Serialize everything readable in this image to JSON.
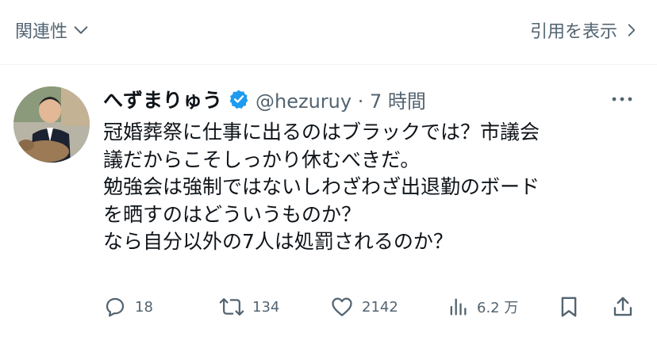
{
  "top_bar": {
    "related_label": "関連性",
    "quotes_label": "引用を表示"
  },
  "tweet": {
    "display_name": "へずまりゅう",
    "handle_time": "@hezuruy · 7 時間",
    "lines": [
      "冠婚葬祭に仕事に出るのはブラックでは？市議会",
      "議だからこそしっかり休むべきだ。",
      "勉強会は強制ではないしわざわざ出退勤のボード",
      "を晒すのはどういうものか？",
      "なら自分以外の7人は処罰されるのか？"
    ],
    "verified_color": "#1d9bf0"
  },
  "actions": {
    "replies": "18",
    "retweets": "134",
    "likes": "2142",
    "views": "6.2 万"
  },
  "icons": [
    "chevron-down-icon",
    "chevron-right-icon",
    "verified-badge-icon",
    "more-icon",
    "reply-icon",
    "retweet-icon",
    "like-icon",
    "views-icon",
    "bookmark-icon",
    "share-icon"
  ]
}
